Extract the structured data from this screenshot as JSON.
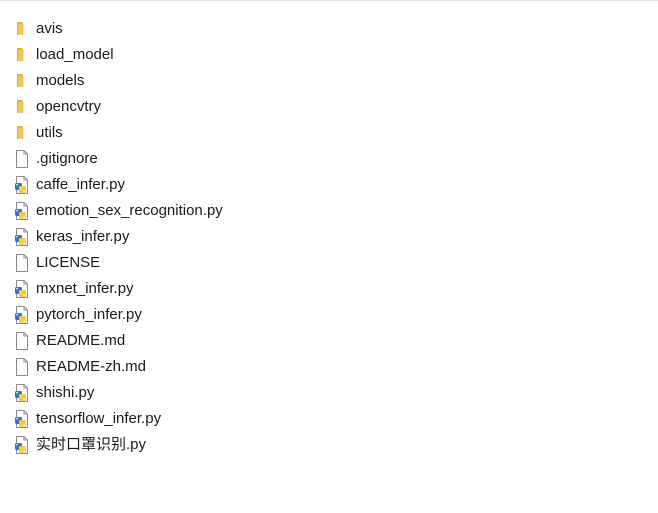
{
  "files": [
    {
      "name": "avis",
      "type": "folder"
    },
    {
      "name": "load_model",
      "type": "folder"
    },
    {
      "name": "models",
      "type": "folder"
    },
    {
      "name": "opencvtry",
      "type": "folder"
    },
    {
      "name": "utils",
      "type": "folder"
    },
    {
      "name": ".gitignore",
      "type": "file"
    },
    {
      "name": "caffe_infer.py",
      "type": "python"
    },
    {
      "name": "emotion_sex_recognition.py",
      "type": "python"
    },
    {
      "name": "keras_infer.py",
      "type": "python"
    },
    {
      "name": "LICENSE",
      "type": "file"
    },
    {
      "name": "mxnet_infer.py",
      "type": "python"
    },
    {
      "name": "pytorch_infer.py",
      "type": "python"
    },
    {
      "name": "README.md",
      "type": "file"
    },
    {
      "name": "README-zh.md",
      "type": "file"
    },
    {
      "name": "shishi.py",
      "type": "python"
    },
    {
      "name": "tensorflow_infer.py",
      "type": "python"
    },
    {
      "name": "实时口罩识别.py",
      "type": "python"
    }
  ],
  "colors": {
    "folder": "#f2c55c",
    "folder_dark": "#dca933",
    "python_blue": "#3a73b8",
    "python_yellow": "#f5cc3d",
    "file_outline": "#8a8a8a"
  }
}
